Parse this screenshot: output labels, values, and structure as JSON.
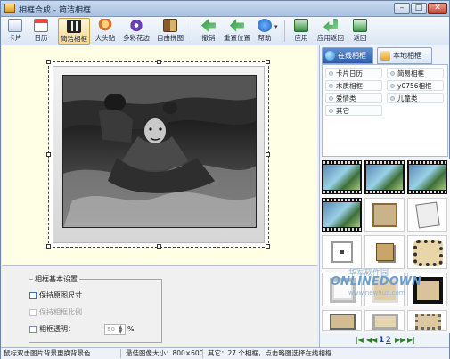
{
  "window": {
    "title": "相框合成 - 简洁相框"
  },
  "toolbar": {
    "items": [
      {
        "label": "卡片",
        "icon": "card-icon"
      },
      {
        "label": "日历",
        "icon": "calendar-icon"
      },
      {
        "label": "简洁相框",
        "icon": "film-frame-icon"
      },
      {
        "label": "大头贴",
        "icon": "sticker-icon"
      },
      {
        "label": "多彩花边",
        "icon": "flower-icon"
      },
      {
        "label": "自由拼图",
        "icon": "puzzle-icon"
      },
      {
        "label": "撤销",
        "icon": "undo-icon"
      },
      {
        "label": "重置位置",
        "icon": "reset-icon"
      },
      {
        "label": "帮助",
        "icon": "help-icon"
      },
      {
        "label": "应用",
        "icon": "apply-icon"
      },
      {
        "label": "应用返回",
        "icon": "apply-return-icon"
      },
      {
        "label": "返回",
        "icon": "return-icon"
      }
    ],
    "active": "简洁相框",
    "dropdown_arrow": "▾"
  },
  "settings": {
    "group_title": "相框基本设置",
    "options": [
      {
        "label": "保持原图尺寸",
        "enabled": true
      },
      {
        "label": "保持相框比例",
        "enabled": false
      },
      {
        "label": "相框透明：",
        "enabled": true
      }
    ],
    "transparency_value": "50",
    "unit": "%"
  },
  "right_panel": {
    "tabs": [
      {
        "label": "在线相框",
        "icon": "globe-icon",
        "active": true
      },
      {
        "label": "本地相框",
        "icon": "folder-icon",
        "active": false
      }
    ],
    "categories": [
      "卡片日历",
      "简易相框",
      "木质相框",
      "y0756相框",
      "爱情类",
      "儿童类",
      "其它"
    ],
    "pager": {
      "first": "|◀",
      "prev": "◀◀",
      "page1": "1",
      "page2": "2",
      "next": "▶▶",
      "last": "▶|"
    }
  },
  "status": {
    "hint": "鼠标双击图片背景更换背景色",
    "size": "最佳图像大小：800×600",
    "info": "其它：27 个相框，点击略图选择在线相框"
  },
  "watermark": {
    "cn": "华军软件园",
    "en": "ONLINEDOWN",
    "url": "www.newhua.com"
  }
}
